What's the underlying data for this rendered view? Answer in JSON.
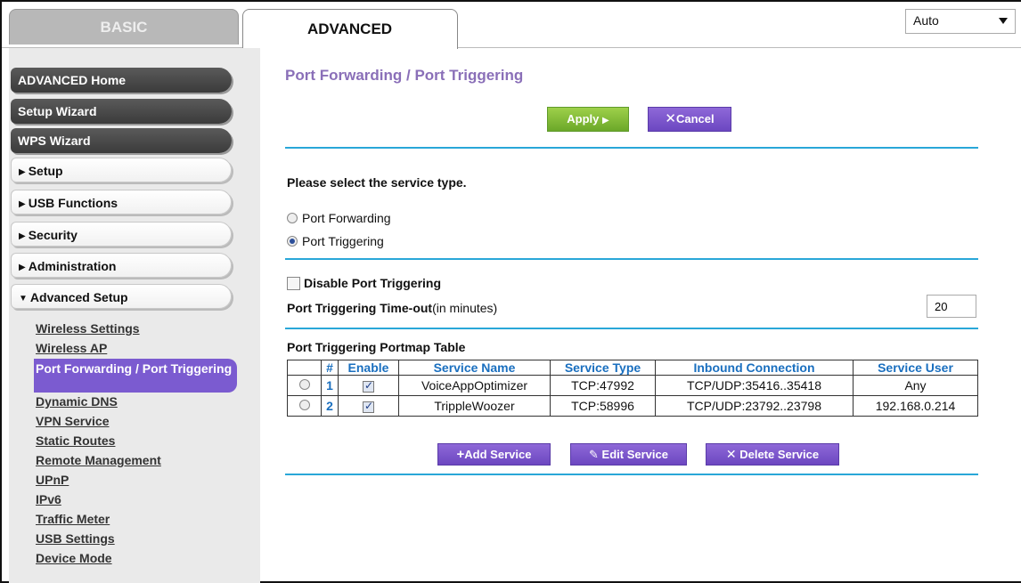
{
  "tabs": {
    "basic": "BASIC",
    "advanced": "ADVANCED"
  },
  "language": {
    "selected": "Auto"
  },
  "sidebar": {
    "main_buttons": [
      "ADVANCED Home",
      "Setup Wizard",
      "WPS Wizard"
    ],
    "sections": [
      "Setup",
      "USB Functions",
      "Security",
      "Administration",
      "Advanced Setup"
    ],
    "advanced_items": [
      "Wireless Settings",
      "Wireless AP",
      "Port Forwarding / Port Triggering",
      "Dynamic DNS",
      "VPN Service",
      "Static Routes",
      "Remote Management",
      "UPnP",
      "IPv6",
      "Traffic Meter",
      "USB Settings",
      "Device Mode"
    ],
    "active_item": "Port Forwarding / Port Triggering"
  },
  "page": {
    "title": "Port Forwarding / Port Triggering",
    "apply_label": "Apply",
    "cancel_label": "Cancel",
    "service_type_prompt": "Please select the service type.",
    "option_forwarding": "Port Forwarding",
    "option_triggering": "Port Triggering",
    "selected_option": "Port Triggering",
    "disable_label": "Disable Port Triggering",
    "disable_checked": false,
    "timeout_label_bold": "Port Triggering Time-out",
    "timeout_label_suffix": "(in minutes)",
    "timeout_value": "20",
    "table_title": "Port Triggering Portmap Table",
    "add_label": "Add Service",
    "edit_label": "Edit Service",
    "delete_label": "Delete Service"
  },
  "table": {
    "headers": [
      "#",
      "Enable",
      "Service Name",
      "Service Type",
      "Inbound Connection",
      "Service User"
    ],
    "rows": [
      {
        "num": "1",
        "enabled": true,
        "name": "VoiceAppOptimizer",
        "type": "TCP:47992",
        "inbound": "TCP/UDP:35416..35418",
        "user": "Any"
      },
      {
        "num": "2",
        "enabled": true,
        "name": "TrippleWoozer",
        "type": "TCP:58996",
        "inbound": "TCP/UDP:23792..23798",
        "user": "192.168.0.214"
      }
    ]
  },
  "colors": {
    "title_purple": "#8a6fb8",
    "accent_blue": "#29a7d8",
    "header_blue": "#1a6fbf",
    "button_purple": "#6c47c1",
    "apply_green": "#6ba829",
    "sidebar_active": "#7b5bd0"
  }
}
